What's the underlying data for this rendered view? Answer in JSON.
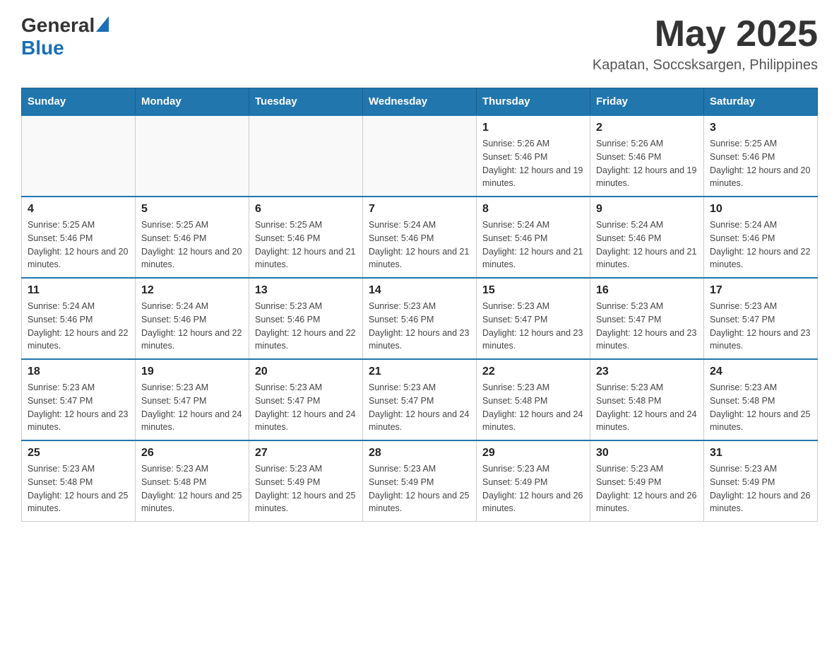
{
  "header": {
    "logo_general": "General",
    "logo_blue": "Blue",
    "month_year": "May 2025",
    "location": "Kapatan, Soccsksargen, Philippines"
  },
  "days_of_week": [
    "Sunday",
    "Monday",
    "Tuesday",
    "Wednesday",
    "Thursday",
    "Friday",
    "Saturday"
  ],
  "weeks": [
    [
      {
        "day": "",
        "info": ""
      },
      {
        "day": "",
        "info": ""
      },
      {
        "day": "",
        "info": ""
      },
      {
        "day": "",
        "info": ""
      },
      {
        "day": "1",
        "info": "Sunrise: 5:26 AM\nSunset: 5:46 PM\nDaylight: 12 hours and 19 minutes."
      },
      {
        "day": "2",
        "info": "Sunrise: 5:26 AM\nSunset: 5:46 PM\nDaylight: 12 hours and 19 minutes."
      },
      {
        "day": "3",
        "info": "Sunrise: 5:25 AM\nSunset: 5:46 PM\nDaylight: 12 hours and 20 minutes."
      }
    ],
    [
      {
        "day": "4",
        "info": "Sunrise: 5:25 AM\nSunset: 5:46 PM\nDaylight: 12 hours and 20 minutes."
      },
      {
        "day": "5",
        "info": "Sunrise: 5:25 AM\nSunset: 5:46 PM\nDaylight: 12 hours and 20 minutes."
      },
      {
        "day": "6",
        "info": "Sunrise: 5:25 AM\nSunset: 5:46 PM\nDaylight: 12 hours and 21 minutes."
      },
      {
        "day": "7",
        "info": "Sunrise: 5:24 AM\nSunset: 5:46 PM\nDaylight: 12 hours and 21 minutes."
      },
      {
        "day": "8",
        "info": "Sunrise: 5:24 AM\nSunset: 5:46 PM\nDaylight: 12 hours and 21 minutes."
      },
      {
        "day": "9",
        "info": "Sunrise: 5:24 AM\nSunset: 5:46 PM\nDaylight: 12 hours and 21 minutes."
      },
      {
        "day": "10",
        "info": "Sunrise: 5:24 AM\nSunset: 5:46 PM\nDaylight: 12 hours and 22 minutes."
      }
    ],
    [
      {
        "day": "11",
        "info": "Sunrise: 5:24 AM\nSunset: 5:46 PM\nDaylight: 12 hours and 22 minutes."
      },
      {
        "day": "12",
        "info": "Sunrise: 5:24 AM\nSunset: 5:46 PM\nDaylight: 12 hours and 22 minutes."
      },
      {
        "day": "13",
        "info": "Sunrise: 5:23 AM\nSunset: 5:46 PM\nDaylight: 12 hours and 22 minutes."
      },
      {
        "day": "14",
        "info": "Sunrise: 5:23 AM\nSunset: 5:46 PM\nDaylight: 12 hours and 23 minutes."
      },
      {
        "day": "15",
        "info": "Sunrise: 5:23 AM\nSunset: 5:47 PM\nDaylight: 12 hours and 23 minutes."
      },
      {
        "day": "16",
        "info": "Sunrise: 5:23 AM\nSunset: 5:47 PM\nDaylight: 12 hours and 23 minutes."
      },
      {
        "day": "17",
        "info": "Sunrise: 5:23 AM\nSunset: 5:47 PM\nDaylight: 12 hours and 23 minutes."
      }
    ],
    [
      {
        "day": "18",
        "info": "Sunrise: 5:23 AM\nSunset: 5:47 PM\nDaylight: 12 hours and 23 minutes."
      },
      {
        "day": "19",
        "info": "Sunrise: 5:23 AM\nSunset: 5:47 PM\nDaylight: 12 hours and 24 minutes."
      },
      {
        "day": "20",
        "info": "Sunrise: 5:23 AM\nSunset: 5:47 PM\nDaylight: 12 hours and 24 minutes."
      },
      {
        "day": "21",
        "info": "Sunrise: 5:23 AM\nSunset: 5:47 PM\nDaylight: 12 hours and 24 minutes."
      },
      {
        "day": "22",
        "info": "Sunrise: 5:23 AM\nSunset: 5:48 PM\nDaylight: 12 hours and 24 minutes."
      },
      {
        "day": "23",
        "info": "Sunrise: 5:23 AM\nSunset: 5:48 PM\nDaylight: 12 hours and 24 minutes."
      },
      {
        "day": "24",
        "info": "Sunrise: 5:23 AM\nSunset: 5:48 PM\nDaylight: 12 hours and 25 minutes."
      }
    ],
    [
      {
        "day": "25",
        "info": "Sunrise: 5:23 AM\nSunset: 5:48 PM\nDaylight: 12 hours and 25 minutes."
      },
      {
        "day": "26",
        "info": "Sunrise: 5:23 AM\nSunset: 5:48 PM\nDaylight: 12 hours and 25 minutes."
      },
      {
        "day": "27",
        "info": "Sunrise: 5:23 AM\nSunset: 5:49 PM\nDaylight: 12 hours and 25 minutes."
      },
      {
        "day": "28",
        "info": "Sunrise: 5:23 AM\nSunset: 5:49 PM\nDaylight: 12 hours and 25 minutes."
      },
      {
        "day": "29",
        "info": "Sunrise: 5:23 AM\nSunset: 5:49 PM\nDaylight: 12 hours and 26 minutes."
      },
      {
        "day": "30",
        "info": "Sunrise: 5:23 AM\nSunset: 5:49 PM\nDaylight: 12 hours and 26 minutes."
      },
      {
        "day": "31",
        "info": "Sunrise: 5:23 AM\nSunset: 5:49 PM\nDaylight: 12 hours and 26 minutes."
      }
    ]
  ]
}
